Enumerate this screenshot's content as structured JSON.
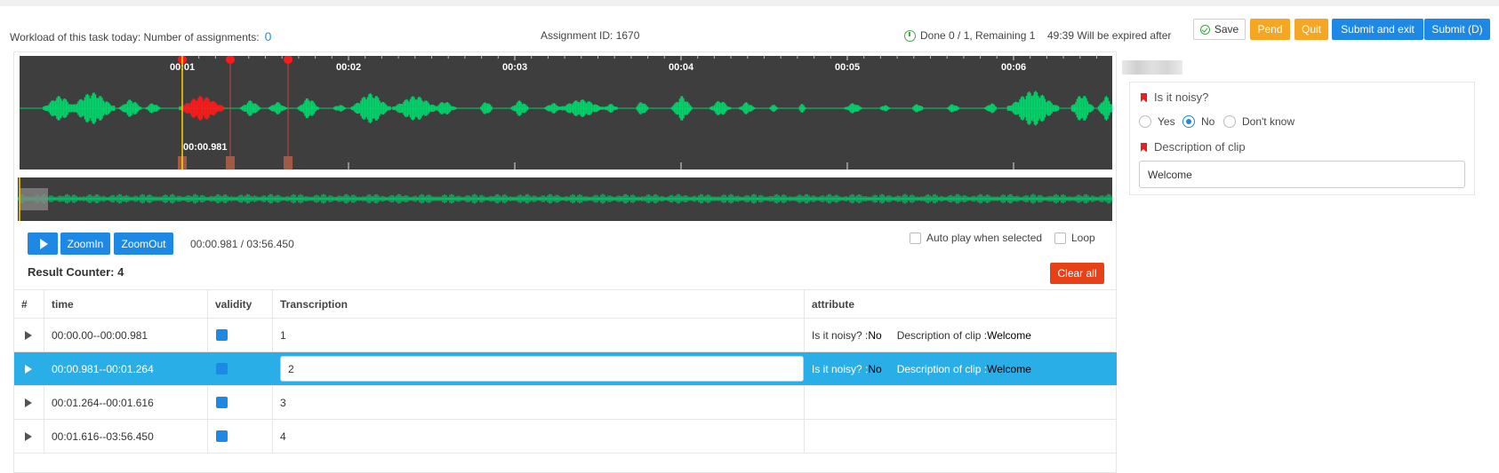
{
  "header": {
    "workload_label": "Workload of this task today: Number of assignments:",
    "workload_count": "0",
    "assignment_id": "Assignment ID: 1670",
    "progress": "Done 0 / 1, Remaining 1",
    "expire": "49:39 Will be expired after",
    "buttons": {
      "save": "Save",
      "pend": "Pend",
      "quit": "Quit",
      "submit_exit": "Submit and exit",
      "submit": "Submit (D)"
    }
  },
  "waveform": {
    "ticks": [
      "00:01",
      "00:02",
      "00:03",
      "00:04",
      "00:05",
      "00:06"
    ],
    "cursor_label": "00:00.981",
    "colors": {
      "wave": "#00d46a",
      "selected": "#ff1a1a",
      "cursor": "#ffd400",
      "background": "#3e3e3e"
    }
  },
  "controls": {
    "zoom_in": "ZoomIn",
    "zoom_out": "ZoomOut",
    "time_position": "00:00.981 / 03:56.450",
    "auto_play": "Auto play when selected",
    "loop": "Loop"
  },
  "results": {
    "counter": "Result Counter: 4",
    "clear_all": "Clear all",
    "columns": [
      "#",
      "time",
      "validity",
      "Transcription",
      "attribute"
    ],
    "rows": [
      {
        "time": "00:00.00--00:00.981",
        "transcription": "1",
        "attr_q1": "Is it noisy? : ",
        "attr_v1": "No",
        "attr_q2": "Description of clip : ",
        "attr_v2": "Welcome"
      },
      {
        "time": "00:00.981--00:01.264",
        "transcription": "2",
        "attr_q1": "Is it noisy? : ",
        "attr_v1": "No",
        "attr_q2": "Description of clip : ",
        "attr_v2": "Welcome"
      },
      {
        "time": "00:01.264--00:01.616",
        "transcription": "3"
      },
      {
        "time": "00:01.616--03:56.450",
        "transcription": "4"
      }
    ]
  },
  "attributes": {
    "q1_label": "Is it noisy?",
    "q1_options": [
      "Yes",
      "No",
      "Don't know"
    ],
    "q1_selected": "No",
    "q2_label": "Description of clip",
    "q2_value": "Welcome"
  }
}
